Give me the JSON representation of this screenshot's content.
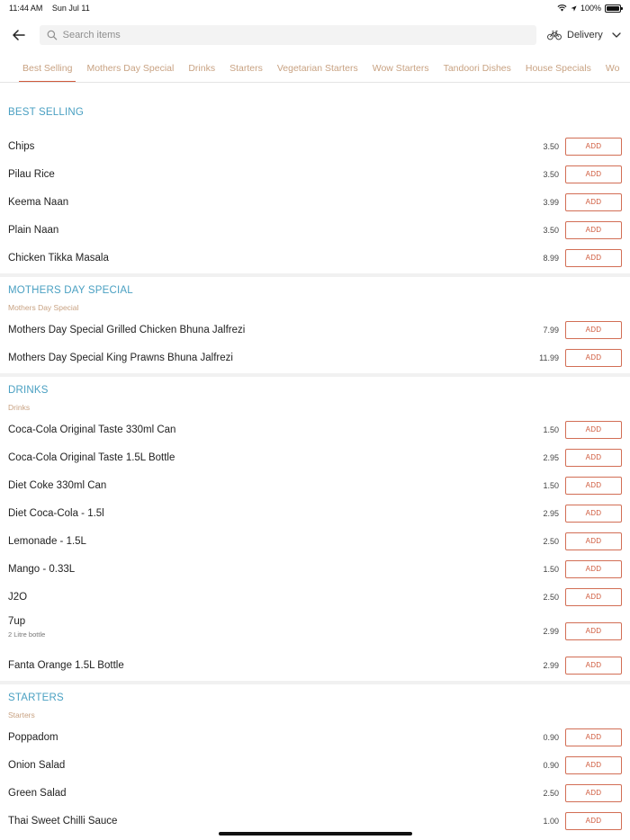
{
  "status": {
    "time": "11:44 AM",
    "date": "Sun Jul 11",
    "battery": "100%"
  },
  "search": {
    "placeholder": "Search items"
  },
  "delivery": {
    "label": "Delivery"
  },
  "tabs": [
    "Best Selling",
    "Mothers Day Special",
    "Drinks",
    "Starters",
    "Vegetarian Starters",
    "Wow Starters",
    "Tandoori Dishes",
    "House Specials",
    "Wo"
  ],
  "active_tab": 0,
  "add_label": "ADD",
  "colors": {
    "accent": "#cf5a3c",
    "section_title": "#4aa0c2",
    "tab_text": "#c8a282"
  },
  "sections": [
    {
      "title": "BEST SELLING",
      "subtitle": "",
      "items": [
        {
          "name": "Chips",
          "price": "3.50"
        },
        {
          "name": "Pilau Rice",
          "price": "3.50"
        },
        {
          "name": "Keema Naan",
          "price": "3.99"
        },
        {
          "name": "Plain Naan",
          "price": "3.50"
        },
        {
          "name": "Chicken Tikka Masala",
          "price": "8.99"
        }
      ]
    },
    {
      "title": "MOTHERS DAY SPECIAL",
      "subtitle": "Mothers Day Special",
      "items": [
        {
          "name": "Mothers Day Special Grilled Chicken Bhuna Jalfrezi",
          "price": "7.99"
        },
        {
          "name": "Mothers Day Special King Prawns Bhuna Jalfrezi",
          "price": "11.99"
        }
      ]
    },
    {
      "title": "DRINKS",
      "subtitle": "Drinks",
      "items": [
        {
          "name": "Coca-Cola Original Taste 330ml Can",
          "price": "1.50"
        },
        {
          "name": "Coca-Cola Original Taste 1.5L Bottle",
          "price": "2.95"
        },
        {
          "name": "Diet Coke 330ml Can",
          "price": "1.50"
        },
        {
          "name": "Diet Coca-Cola - 1.5l",
          "price": "2.95"
        },
        {
          "name": "Lemonade - 1.5L",
          "price": "2.50"
        },
        {
          "name": "Mango - 0.33L",
          "price": "1.50"
        },
        {
          "name": "J2O",
          "price": "2.50"
        },
        {
          "name": "7up",
          "price": "2.99",
          "description": "2 Litre bottle"
        },
        {
          "name": "Fanta Orange 1.5L Bottle",
          "price": "2.99"
        }
      ]
    },
    {
      "title": "STARTERS",
      "subtitle": "Starters",
      "items": [
        {
          "name": "Poppadom",
          "price": "0.90"
        },
        {
          "name": "Onion Salad",
          "price": "0.90"
        },
        {
          "name": "Green Salad",
          "price": "2.50"
        },
        {
          "name": "Thai Sweet Chilli Sauce",
          "price": "1.00"
        }
      ]
    }
  ]
}
